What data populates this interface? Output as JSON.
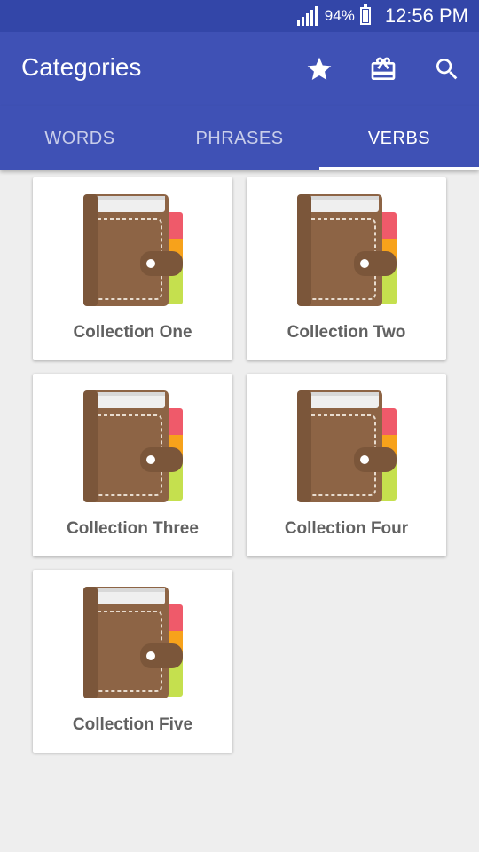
{
  "status_bar": {
    "battery": "94%",
    "time": "12:56 PM"
  },
  "app_bar": {
    "title": "Categories",
    "actions": [
      {
        "icon": "star-icon"
      },
      {
        "icon": "gift-card-icon"
      },
      {
        "icon": "search-icon"
      }
    ]
  },
  "tabs": [
    {
      "label": "WORDS",
      "active": false
    },
    {
      "label": "PHRASES",
      "active": false
    },
    {
      "label": "VERBS",
      "active": true
    }
  ],
  "collections": [
    {
      "label": "Collection One",
      "icon": "book-icon"
    },
    {
      "label": "Collection Two",
      "icon": "book-icon"
    },
    {
      "label": "Collection Three",
      "icon": "book-icon"
    },
    {
      "label": "Collection Four",
      "icon": "book-icon"
    },
    {
      "label": "Collection Five",
      "icon": "book-icon"
    }
  ],
  "colors": {
    "primary": "#3f51b5",
    "status_bar": "#3346a8",
    "background": "#eeeeee",
    "book_brown": "#8d6445",
    "tab_red": "#ef5a6a",
    "tab_orange": "#f7a21b",
    "tab_green": "#c5e04e"
  }
}
